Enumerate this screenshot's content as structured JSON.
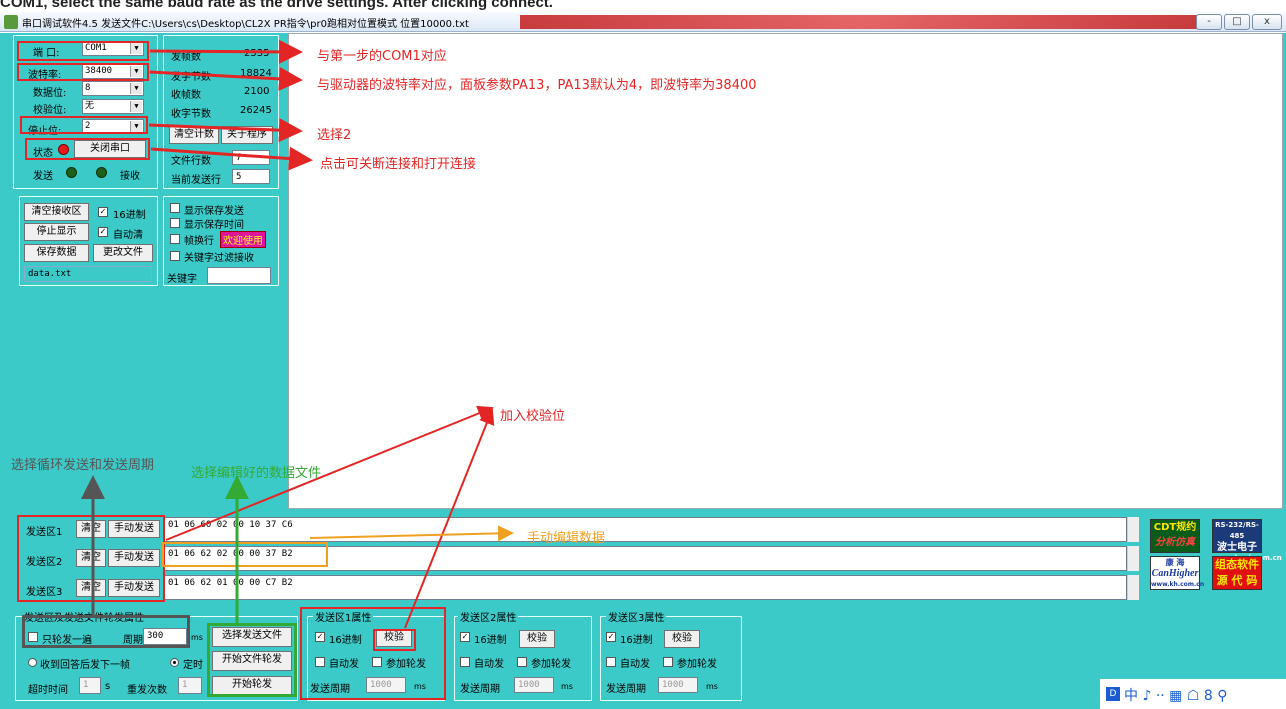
{
  "caption_top": "COM1, select the same baud rate as the drive settings. After clicking connect.",
  "title": "串口调试软件4.5 发送文件C:\\Users\\cs\\Desktop\\CL2X PR指令\\pr0跑相对位置模式 位置10000.txt",
  "window_buttons": [
    "-",
    "□",
    "x"
  ],
  "port": {
    "port_label": "端 口:",
    "port_value": "COM1",
    "baud_label": "波特率:",
    "baud_value": "38400",
    "databits_label": "数据位:",
    "databits_value": "8",
    "parity_label": "校验位:",
    "parity_value": "无",
    "stopbits_label": "停止位:",
    "stopbits_value": "2",
    "status_label": "状态",
    "close_port": "关闭串口",
    "send_label": "发送",
    "recv_label": "接收"
  },
  "stats": {
    "tx_frames_label": "发帧数",
    "tx_frames": "2535",
    "tx_bytes_label": "发字节数",
    "tx_bytes": "18824",
    "rx_frames_label": "收帧数",
    "rx_frames": "2100",
    "rx_bytes_label": "收字节数",
    "rx_bytes": "26245",
    "clear_count": "清空计数",
    "about": "关于程序",
    "file_lines_label": "文件行数",
    "file_lines": "7",
    "current_line_label": "当前发送行",
    "current_line": "5"
  },
  "recv_controls": {
    "clear_recv": "清空接收区",
    "hex_label": "16进制",
    "stop_display": "停止显示",
    "auto_clear": "自动清",
    "save_data": "保存数据",
    "change_file": "更改文件",
    "filename": "data.txt"
  },
  "display_opts": {
    "show_save_send": "显示保存发送",
    "show_save_time": "显示保存时间",
    "frame_wrap": "帧换行",
    "welcome": "欢迎使用",
    "keyword_filter": "关键字过滤接收",
    "keyword_label": "关键字"
  },
  "send_areas": [
    {
      "label": "发送区1",
      "clear": "清空",
      "manual": "手动发送",
      "data": "01 06 60 02 00 10  37 C6"
    },
    {
      "label": "发送区2",
      "clear": "清空",
      "manual": "手动发送",
      "data": "01 06 62 02 00 00   37 B2"
    },
    {
      "label": "发送区3",
      "clear": "清空",
      "manual": "手动发送",
      "data": "01 06 62 01 00 00 C7 B2"
    }
  ],
  "cycle": {
    "title": "发送区及发送文件轮发属性",
    "once": "只轮发一遍",
    "period_label": "周期",
    "period": "300",
    "ms": "ms",
    "on_reply": "收到回答后发下一帧",
    "timed": "定时",
    "timeout_label": "超时时间",
    "timeout": "1",
    "s": "s",
    "resend_label": "重发次数",
    "resend": "1",
    "select_file": "选择发送文件",
    "start_file_cycle": "开始文件轮发",
    "start_cycle": "开始轮发"
  },
  "props": [
    {
      "title": "发送区1属性",
      "hex": "16进制",
      "check": "校验",
      "auto": "自动发",
      "join": "参加轮发",
      "period_label": "发送周期",
      "period": "1000",
      "ms": "ms"
    },
    {
      "title": "发送区2属性",
      "hex": "16进制",
      "check": "校验",
      "auto": "自动发",
      "join": "参加轮发",
      "period_label": "发送周期",
      "period": "1000",
      "ms": "ms"
    },
    {
      "title": "发送区3属性",
      "hex": "16进制",
      "check": "校验",
      "auto": "自动发",
      "join": "参加轮发",
      "period_label": "发送周期",
      "period": "1000",
      "ms": "ms"
    }
  ],
  "logos": {
    "cdt_1": "CDT规约",
    "cdt_2": "分析仿真",
    "rs_1": "RS-232/RS-485",
    "rs_2": "波士电子",
    "rs_3": "www.bosi.com.cn",
    "kh_1": "康 海",
    "kh_2": "CanHigher",
    "kh_3": "www.kh.com.cn",
    "zt_1": "组态软件",
    "zt_2": "源 代 码"
  },
  "annotations": {
    "a1": "与第一步的COM1对应",
    "a2": "与驱动器的波特率对应，面板参数PA13，PA13默认为4，即波特率为38400",
    "a3": "选择2",
    "a4": "点击可关断连接和打开连接",
    "a5": "加入校验位",
    "a6": "选择循环发送和发送周期",
    "a7": "选择编辑好的数据文件",
    "a8": "手动编辑数据"
  },
  "colors": {
    "red": "#e32525",
    "orange": "#f0a020",
    "green": "#33aa33",
    "gray": "#555555",
    "teal": "#3ccac8"
  },
  "tray": "中 ♪ ·· ▦ ☖ 8 ⚲"
}
